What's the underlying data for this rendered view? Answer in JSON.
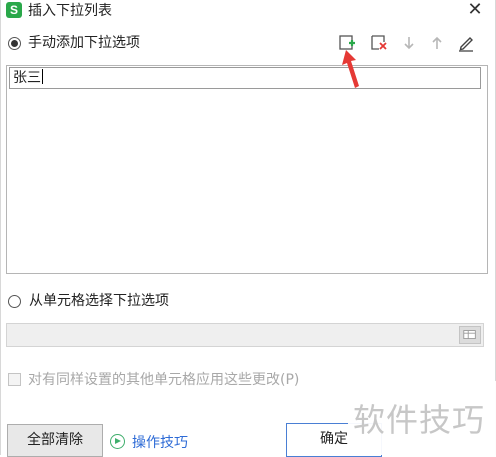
{
  "window": {
    "app_icon_glyph": "S",
    "title": "插入下拉列表",
    "close_glyph": "✕"
  },
  "manual": {
    "label": "手动添加下拉选项",
    "selected": true,
    "toolbar": {
      "add_icon": "add-item-icon",
      "delete_icon": "delete-item-icon",
      "move_down_icon": "arrow-down-icon",
      "move_up_icon": "arrow-up-icon",
      "edit_icon": "pencil-icon"
    },
    "items": [
      "张三"
    ]
  },
  "from_cells": {
    "label": "从单元格选择下拉选项",
    "selected": false
  },
  "apply_all": {
    "label": "对有同样设置的其他单元格应用这些更改(P)",
    "checked": false
  },
  "footer": {
    "clear_label": "全部清除",
    "tips_label": "操作技巧",
    "ok_label": "确定"
  },
  "watermark": {
    "text": "软件技巧"
  },
  "colors": {
    "accent_green": "#2aa84a",
    "link_blue": "#2e6bd6",
    "annotation_red": "#e53935"
  }
}
